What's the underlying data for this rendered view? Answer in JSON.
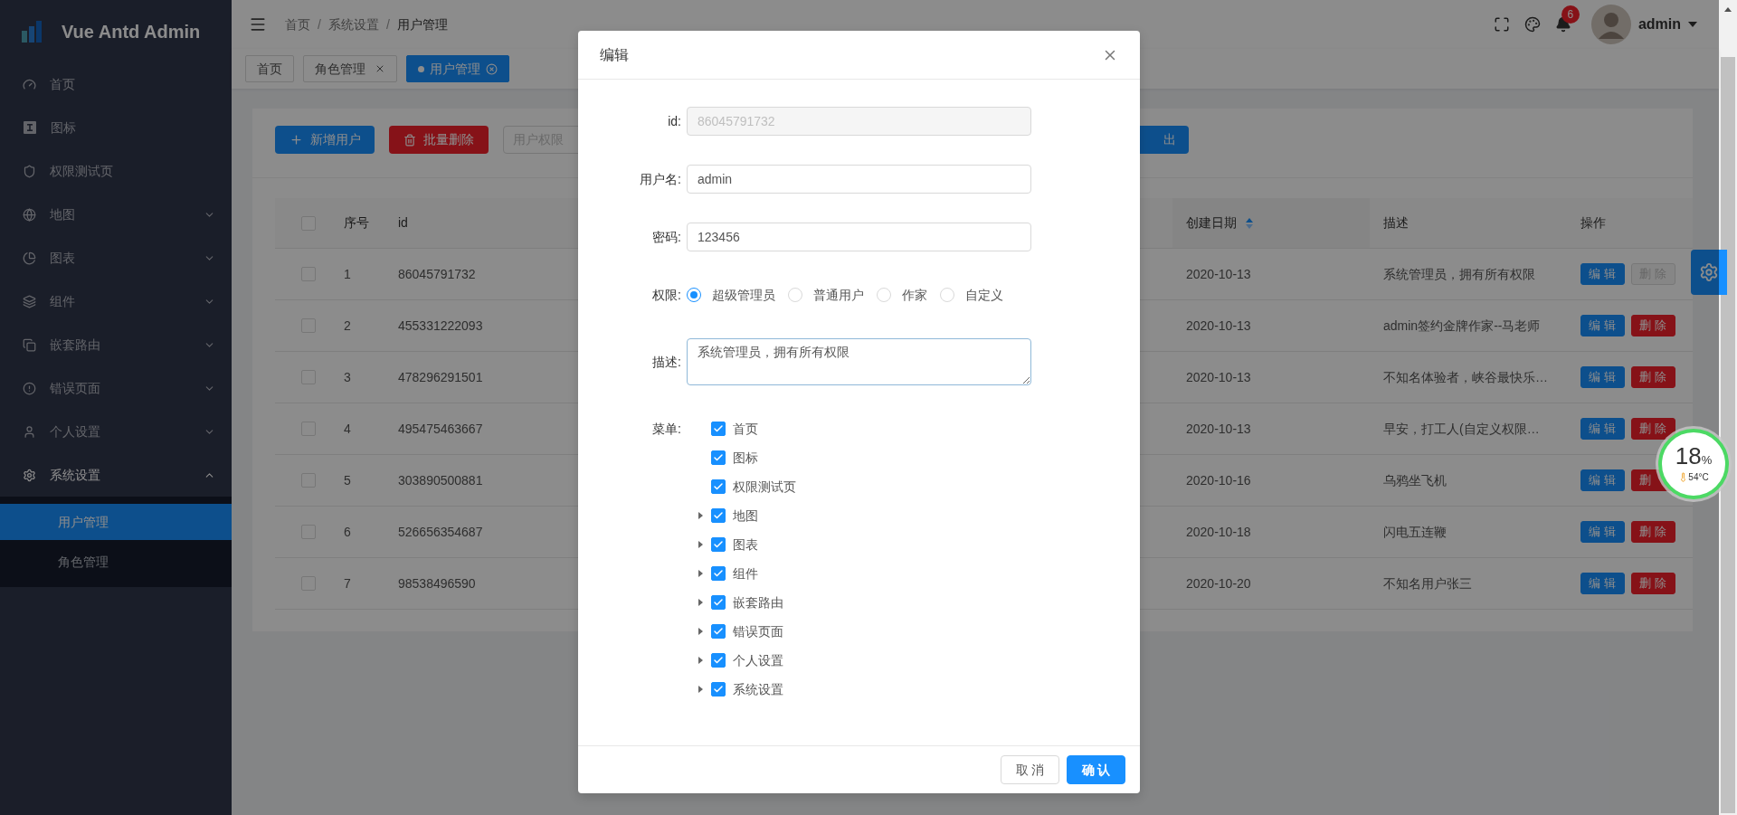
{
  "sidebar": {
    "logo_text": "Vue Antd Admin",
    "items": [
      {
        "label": "首页",
        "selected": false
      },
      {
        "label": "图标",
        "selected": false
      },
      {
        "label": "权限测试页",
        "selected": false
      },
      {
        "label": "地图",
        "selected": false,
        "expanded": false
      },
      {
        "label": "图表",
        "selected": false,
        "expanded": false
      },
      {
        "label": "组件",
        "selected": false,
        "expanded": false
      },
      {
        "label": "嵌套路由",
        "selected": false,
        "expanded": false
      },
      {
        "label": "错误页面",
        "selected": false,
        "expanded": false
      },
      {
        "label": "个人设置",
        "selected": false,
        "expanded": false
      },
      {
        "label": "系统设置",
        "selected": false,
        "expanded": true,
        "children": [
          {
            "label": "用户管理",
            "selected": true
          },
          {
            "label": "角色管理",
            "selected": false
          }
        ]
      }
    ]
  },
  "header": {
    "breadcrumb": [
      "首页",
      "系统设置",
      "用户管理"
    ],
    "breadcrumb_separator": "/",
    "notification_count": "6",
    "user": "admin"
  },
  "tabs": [
    {
      "label": "首页",
      "selected": false,
      "closable": false
    },
    {
      "label": "角色管理",
      "selected": false,
      "closable": true
    },
    {
      "label": "用户管理",
      "selected": true,
      "closable": true
    }
  ],
  "toolbar": {
    "buttons": [
      {
        "label": "新增用户",
        "kind": "primary"
      },
      {
        "label": "批量删除",
        "kind": "danger"
      }
    ],
    "select": {
      "placeholder": "用户权限"
    },
    "export_button": "出"
  },
  "table": {
    "select_all": {
      "checked": false
    },
    "columns": [
      {
        "label": "序号"
      },
      {
        "label": "id"
      },
      {
        "label": "创建日期",
        "sortable": true
      },
      {
        "label": "描述"
      },
      {
        "label": "操作"
      }
    ],
    "rows": [
      {
        "checked": false,
        "index": "1",
        "id": "86045791732",
        "date": "2020-10-13",
        "description": "系统管理员，拥有所有权限",
        "actions": [
          {
            "label": "编 辑",
            "kind": "edit",
            "disabled": false
          },
          {
            "label": "删 除",
            "kind": "delete",
            "disabled": true
          }
        ]
      },
      {
        "checked": false,
        "index": "2",
        "id": "455331222093",
        "date": "2020-10-13",
        "description": "admin签约金牌作家--马老师",
        "actions": [
          {
            "label": "编 辑",
            "kind": "edit",
            "disabled": false
          },
          {
            "label": "删 除",
            "kind": "delete",
            "disabled": false
          }
        ]
      },
      {
        "checked": false,
        "index": "3",
        "id": "478296291501",
        "date": "2020-10-13",
        "description": "不知名体验者，峡谷最快乐…",
        "actions": [
          {
            "label": "编 辑",
            "kind": "edit",
            "disabled": false
          },
          {
            "label": "删 除",
            "kind": "delete",
            "disabled": false
          }
        ]
      },
      {
        "checked": false,
        "index": "4",
        "id": "495475463667",
        "date": "2020-10-13",
        "description": "早安，打工人(自定义权限…",
        "actions": [
          {
            "label": "编 辑",
            "kind": "edit",
            "disabled": false
          },
          {
            "label": "删 除",
            "kind": "delete",
            "disabled": false
          }
        ]
      },
      {
        "checked": false,
        "index": "5",
        "id": "303890500881",
        "date": "2020-10-16",
        "description": "乌鸦坐飞机",
        "actions": [
          {
            "label": "编 辑",
            "kind": "edit",
            "disabled": false
          },
          {
            "label": "删",
            "kind": "delete",
            "disabled": false
          }
        ]
      },
      {
        "checked": false,
        "index": "6",
        "id": "526656354687",
        "date": "2020-10-18",
        "description": "闪电五连鞭",
        "actions": [
          {
            "label": "编 辑",
            "kind": "edit",
            "disabled": false
          },
          {
            "label": "删 除",
            "kind": "delete",
            "disabled": false
          }
        ]
      },
      {
        "checked": false,
        "index": "7",
        "id": "98538496590",
        "date": "2020-10-20",
        "description": "不知名用户张三",
        "actions": [
          {
            "label": "编 辑",
            "kind": "edit",
            "disabled": false
          },
          {
            "label": "删 除",
            "kind": "delete",
            "disabled": false
          }
        ]
      }
    ]
  },
  "modal": {
    "title": "编辑",
    "fields": [
      {
        "label": "id:",
        "kind": "input",
        "value": "86045791732",
        "disabled": true
      },
      {
        "label": "用户名:",
        "kind": "input",
        "value": "admin",
        "disabled": false
      },
      {
        "label": "密码:",
        "kind": "input",
        "value": "123456",
        "disabled": false
      },
      {
        "label": "权限:",
        "kind": "radio",
        "options": [
          {
            "label": "超级管理员",
            "selected": true
          },
          {
            "label": "普通用户",
            "selected": false
          },
          {
            "label": "作家",
            "selected": false
          },
          {
            "label": "自定义",
            "selected": false
          }
        ]
      },
      {
        "label": "描述:",
        "kind": "textarea",
        "value": "系统管理员，拥有所有权限"
      },
      {
        "label": "菜单:",
        "kind": "tree",
        "nodes": [
          {
            "label": "首页",
            "checked": true,
            "kind": "leaf"
          },
          {
            "label": "图标",
            "checked": true,
            "kind": "leaf"
          },
          {
            "label": "权限测试页",
            "checked": true,
            "kind": "leaf"
          },
          {
            "label": "地图",
            "checked": true,
            "kind": "branch",
            "expanded": false
          },
          {
            "label": "图表",
            "checked": true,
            "kind": "branch",
            "expanded": false
          },
          {
            "label": "组件",
            "checked": true,
            "kind": "branch",
            "expanded": false
          },
          {
            "label": "嵌套路由",
            "checked": true,
            "kind": "branch",
            "expanded": false
          },
          {
            "label": "错误页面",
            "checked": true,
            "kind": "branch",
            "expanded": false
          },
          {
            "label": "个人设置",
            "checked": true,
            "kind": "branch",
            "expanded": false
          },
          {
            "label": "系统设置",
            "checked": true,
            "kind": "branch",
            "expanded": false
          }
        ]
      }
    ],
    "buttons": [
      {
        "label": "取 消",
        "kind": "default"
      },
      {
        "label": "确 认",
        "kind": "primary"
      }
    ]
  },
  "monitor_widget": {
    "value": "18",
    "unit": "%",
    "temperature": "54°C"
  }
}
